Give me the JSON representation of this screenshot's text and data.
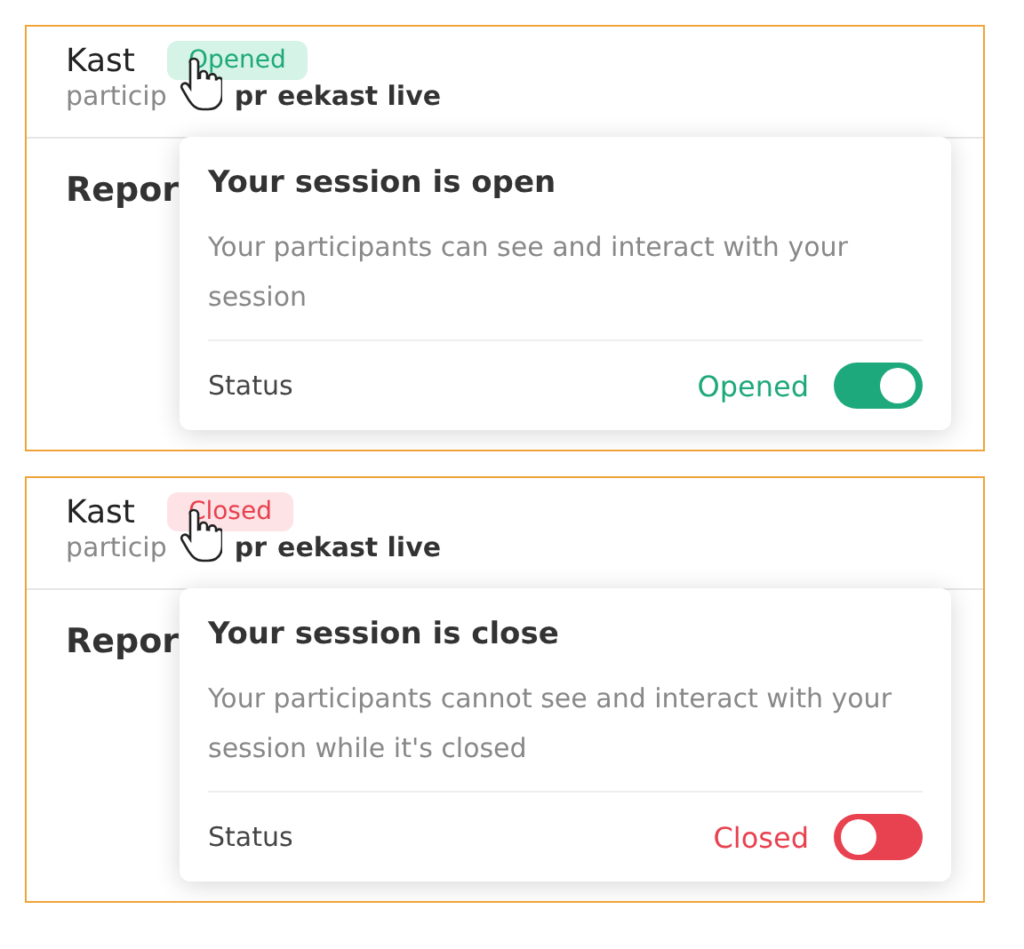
{
  "panels": [
    {
      "title": "Kast",
      "badge": {
        "label": "Opened",
        "open": true
      },
      "subtitle": "particip",
      "subtitle_strong": [
        "pr",
        "eekast live"
      ],
      "section": "Repor",
      "popover": {
        "title": "Your session is open",
        "description": "Your participants can see and interact with your session",
        "status_label": "Status",
        "status_value": "Opened",
        "on": true
      }
    },
    {
      "title": "Kast",
      "badge": {
        "label": "Closed",
        "open": false
      },
      "subtitle": "particip",
      "subtitle_strong": [
        "pr",
        "eekast live"
      ],
      "section": "Repor",
      "popover": {
        "title": "Your session is close",
        "description": "Your participants cannot see and interact with your session while it's closed",
        "status_label": "Status",
        "status_value": "Closed",
        "on": false
      }
    }
  ]
}
